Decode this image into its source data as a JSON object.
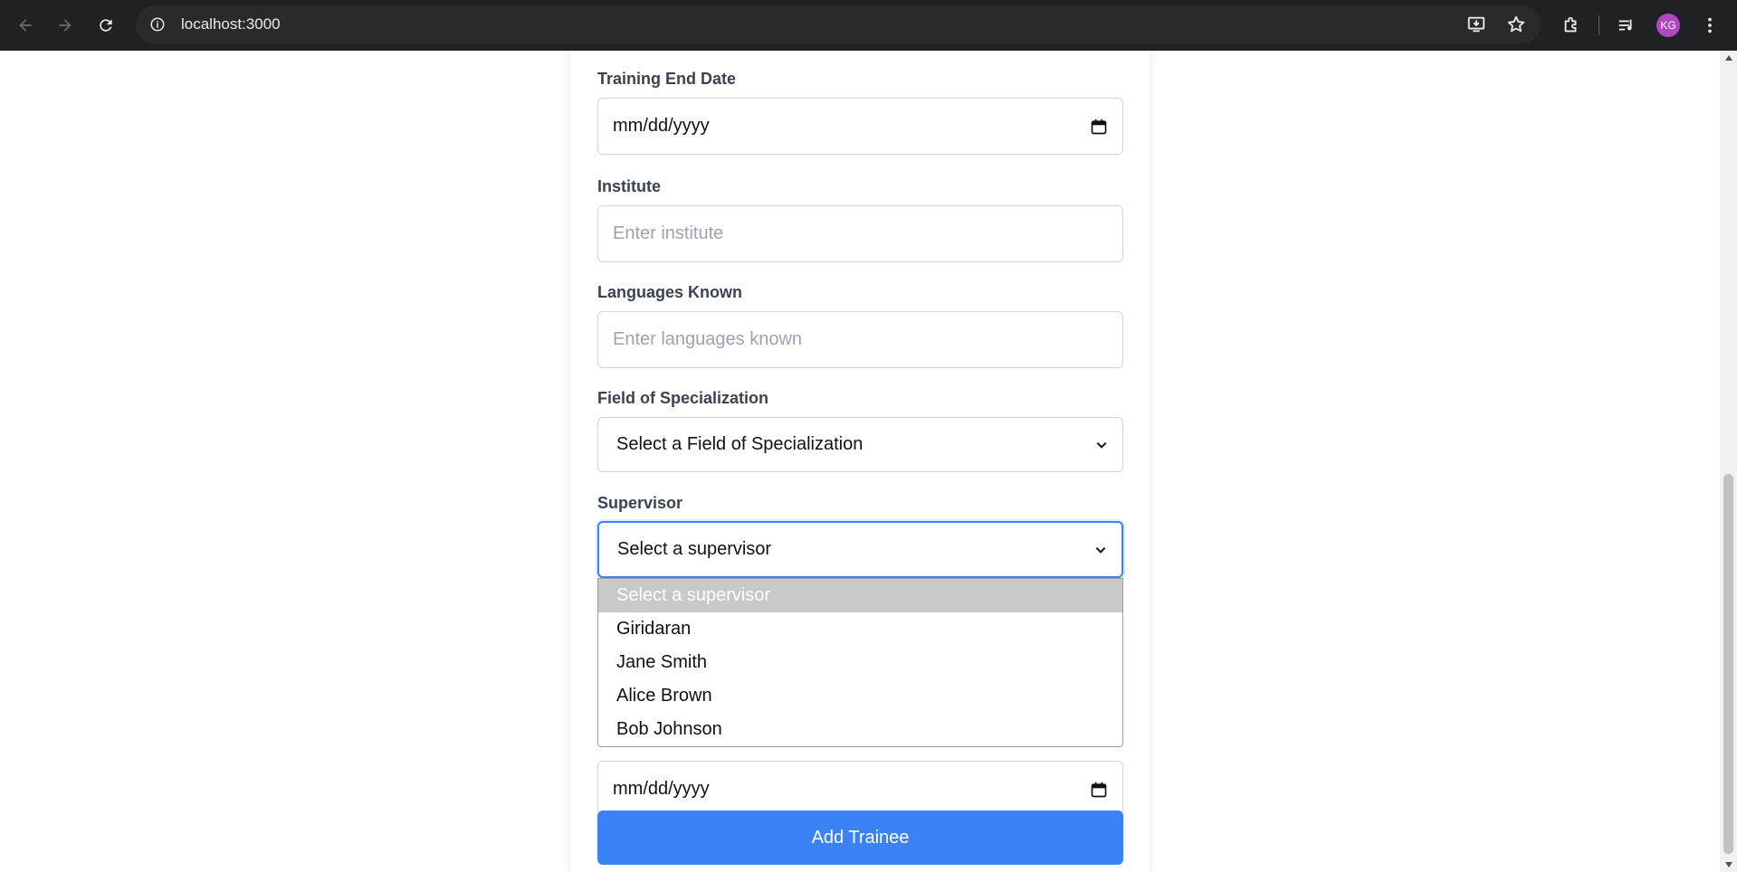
{
  "browser": {
    "url": "localhost:3000",
    "avatar_initials": "KG",
    "icons": {
      "back": "arrow-left-icon",
      "forward": "arrow-right-icon",
      "reload": "reload-icon",
      "site_info": "info-icon",
      "install": "install-app-icon",
      "bookmark": "star-icon",
      "extensions": "puzzle-icon",
      "media": "media-control-icon",
      "menu": "kebab-menu-icon"
    }
  },
  "form": {
    "training_end_date": {
      "label": "Training End Date",
      "value": "mm/dd/yyyy"
    },
    "institute": {
      "label": "Institute",
      "placeholder": "Enter institute"
    },
    "languages_known": {
      "label": "Languages Known",
      "placeholder": "Enter languages known"
    },
    "field_of_specialization": {
      "label": "Field of Specialization",
      "selected": "Select a Field of Specialization"
    },
    "supervisor": {
      "label": "Supervisor",
      "selected": "Select a supervisor",
      "options": [
        "Select a supervisor",
        "Giridaran",
        "Jane Smith",
        "Alice Brown",
        "Bob Johnson"
      ]
    },
    "lower_date": {
      "value": "mm/dd/yyyy"
    },
    "submit_label": "Add Trainee"
  },
  "colors": {
    "primary": "#3b82f6",
    "chrome_bg": "#202124",
    "option_highlight": "#c8c8c8"
  }
}
